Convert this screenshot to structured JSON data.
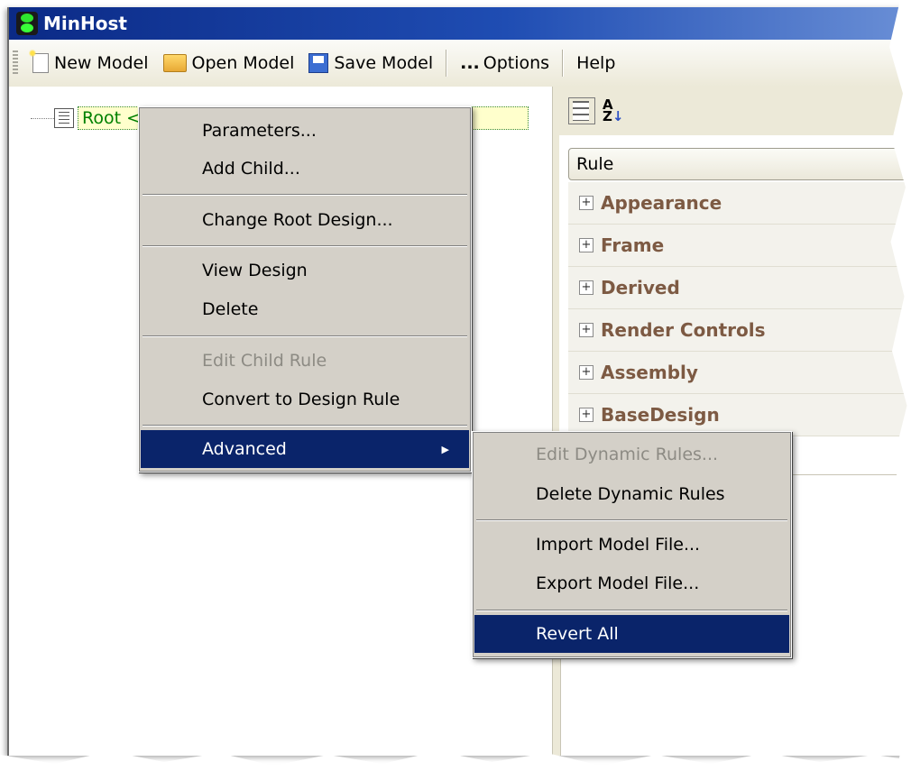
{
  "window": {
    "title": "MinHost"
  },
  "toolbar": {
    "new_model": "New Model",
    "open_model": "Open Model",
    "save_model": "Save Model",
    "options_dots": "...",
    "options": "Options",
    "help": "Help"
  },
  "tree": {
    "root_label": "Root <"
  },
  "property_grid": {
    "header": "Rule",
    "categories": [
      "Appearance",
      "Frame",
      "Derived",
      "Render Controls",
      "Assembly",
      "BaseDesign"
    ]
  },
  "context_menu": {
    "parameters": "Parameters...",
    "add_child": "Add Child...",
    "change_root_design": "Change Root Design...",
    "view_design": "View Design",
    "delete": "Delete",
    "edit_child_rule": "Edit Child Rule",
    "convert_to_design_rule": "Convert to Design Rule",
    "advanced": "Advanced",
    "submenu_arrow": "▶"
  },
  "advanced_menu": {
    "edit_dynamic_rules": "Edit Dynamic Rules...",
    "delete_dynamic_rules": "Delete Dynamic Rules",
    "import_model_file": "Import Model File...",
    "export_model_file": "Export Model File...",
    "revert_all": "Revert All"
  },
  "colors": {
    "menu_highlight": "#0a246a",
    "category_text": "#7d5a43",
    "tree_label_text": "#008000"
  }
}
